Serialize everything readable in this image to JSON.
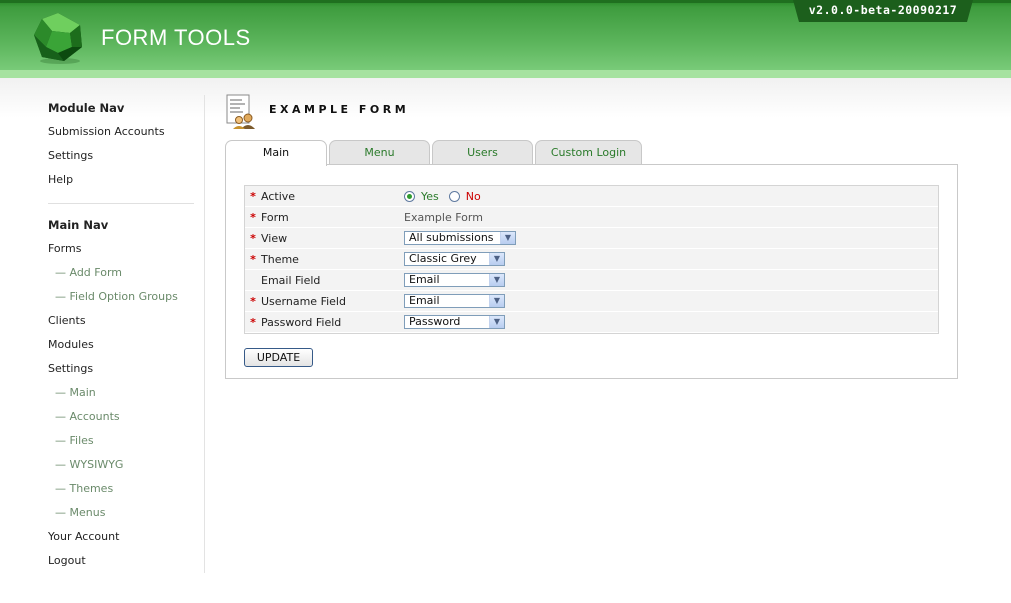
{
  "header": {
    "logo_text": "FORM TOOLS",
    "version": "v2.0.0-beta-20090217",
    "colors": {
      "header_green": "#4caa4c",
      "strip": "#a6e2a0",
      "badge": "#1c5f1c"
    }
  },
  "sidebar": {
    "module_nav_title": "Module Nav",
    "module_nav": [
      "Submission Accounts",
      "Settings",
      "Help"
    ],
    "main_nav_title": "Main Nav",
    "main_nav": [
      {
        "label": "Forms",
        "sub": false
      },
      {
        "label": "— Add Form",
        "sub": true
      },
      {
        "label": "— Field Option Groups",
        "sub": true
      },
      {
        "label": "Clients",
        "sub": false
      },
      {
        "label": "Modules",
        "sub": false
      },
      {
        "label": "Settings",
        "sub": false
      },
      {
        "label": "— Main",
        "sub": true
      },
      {
        "label": "— Accounts",
        "sub": true
      },
      {
        "label": "— Files",
        "sub": true
      },
      {
        "label": "— WYSIWYG",
        "sub": true
      },
      {
        "label": "— Themes",
        "sub": true
      },
      {
        "label": "— Menus",
        "sub": true
      },
      {
        "label": "Your Account",
        "sub": false
      },
      {
        "label": "Logout",
        "sub": false
      }
    ]
  },
  "main": {
    "title": "EXAMPLE FORM",
    "tabs": [
      {
        "label": "Main",
        "active": true
      },
      {
        "label": "Menu",
        "active": false
      },
      {
        "label": "Users",
        "active": false
      },
      {
        "label": "Custom Login",
        "active": false
      }
    ],
    "fields": {
      "active": {
        "label": "Active",
        "required": true,
        "yes_label": "Yes",
        "no_label": "No",
        "selected": "Yes"
      },
      "form": {
        "label": "Form",
        "required": true,
        "value": "Example Form"
      },
      "view": {
        "label": "View",
        "required": true,
        "value": "All submissions"
      },
      "theme": {
        "label": "Theme",
        "required": true,
        "value": "Classic Grey"
      },
      "email_field": {
        "label": "Email Field",
        "required": false,
        "value": "Email"
      },
      "username_field": {
        "label": "Username Field",
        "required": true,
        "value": "Email"
      },
      "password_field": {
        "label": "Password Field",
        "required": true,
        "value": "Password"
      }
    },
    "required_marker": "*",
    "update_label": "UPDATE"
  },
  "icons": {
    "logo": "green-gem-icon",
    "page": "form-document-users-icon",
    "select_arrow": "chevron-down-icon"
  }
}
